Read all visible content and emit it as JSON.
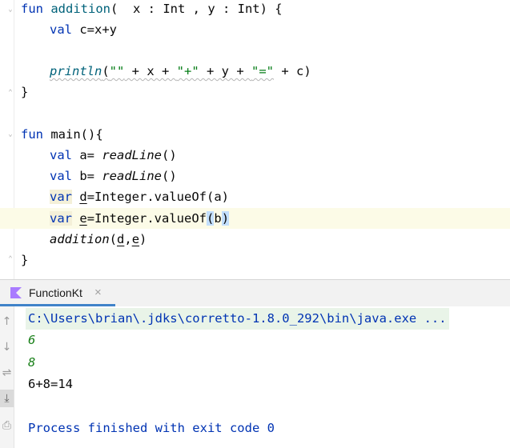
{
  "editor": {
    "lines": {
      "l1": {
        "kw": "fun",
        "fn": "addition",
        "rest": "(  x : Int , y : Int) {"
      },
      "l2": {
        "kw": "val",
        "rest": " c=x+y"
      },
      "l4": {
        "fn": "println",
        "open": "(",
        "s1": "\"\"",
        "p1": " + x + ",
        "s2": "\"+\"",
        "p2": " + y + ",
        "s3": "\"=\"",
        "p3": " + c)"
      },
      "l5": {
        "text": "}"
      },
      "l7": {
        "kw": "fun",
        "rest": " main(){"
      },
      "l8": {
        "kw": "val",
        "mid": " a= ",
        "fn": "readLine",
        "end": "()"
      },
      "l9": {
        "kw": "val",
        "mid": " b= ",
        "fn": "readLine",
        "end": "()"
      },
      "l10": {
        "kw": "var",
        "sp": " ",
        "var": "d",
        "rest": "=Integer.valueOf(a)"
      },
      "l11": {
        "kw": "var",
        "sp": " ",
        "var": "e",
        "rest": "=Integer.valueOf",
        "open": "(",
        "arg": "b",
        "close": ")"
      },
      "l12": {
        "fn": "addition",
        "open": "(",
        "a1": "d",
        "comma": ",",
        "a2": "e",
        "close": ")"
      },
      "l13": {
        "text": "}"
      }
    }
  },
  "run_panel": {
    "tab_label": "FunctionKt",
    "close_glyph": "×",
    "toolbar_icons": [
      "arrow-up-icon",
      "arrow-down-icon",
      "soft-wrap-icon",
      "scroll-to-end-icon",
      "print-icon"
    ],
    "toolbar_glyphs": {
      "up": "↑",
      "down": "↓",
      "wrap": "⇌",
      "scroll": "⤓",
      "print": "⎙"
    },
    "console": {
      "command": "C:\\Users\\brian\\.jdks\\corretto-1.8.0_292\\bin\\java.exe ...",
      "input1": "6",
      "input2": "8",
      "output": "6+8=14",
      "exit": "Process finished with exit code 0"
    }
  },
  "colors": {
    "keyword": "#0033b3",
    "function": "#00627a",
    "string": "#067d17",
    "current_line": "#fcfbe7",
    "tab_underline": "#4083c9"
  }
}
